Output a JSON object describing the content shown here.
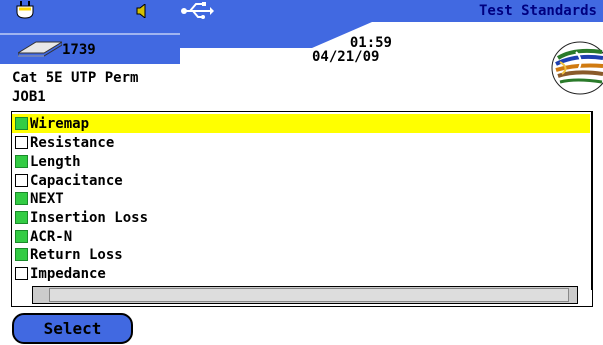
{
  "header": {
    "title": "Test Standards",
    "count": "1739",
    "time": "01:59",
    "date": "04/21/09",
    "icons": [
      "power-plug-icon",
      "speaker-icon",
      "usb-icon",
      "storage-card-icon",
      "cable-bundle-icon"
    ],
    "band_color": "#4169e1"
  },
  "info": {
    "cable_type": "Cat 5E UTP Perm",
    "job": "JOB1"
  },
  "tests": [
    {
      "label": "Wiremap",
      "checked": true,
      "selected": true
    },
    {
      "label": "Resistance",
      "checked": false,
      "selected": false
    },
    {
      "label": "Length",
      "checked": true,
      "selected": false
    },
    {
      "label": "Capacitance",
      "checked": false,
      "selected": false
    },
    {
      "label": "NEXT",
      "checked": true,
      "selected": false
    },
    {
      "label": "Insertion Loss",
      "checked": true,
      "selected": false
    },
    {
      "label": "ACR-N",
      "checked": true,
      "selected": false
    },
    {
      "label": "Return Loss",
      "checked": true,
      "selected": false
    },
    {
      "label": "Impedance",
      "checked": false,
      "selected": false
    }
  ],
  "footer": {
    "select_label": "Select"
  },
  "colors": {
    "highlight": "#ffff00",
    "check_on": "#33cc44",
    "button": "#4169e1"
  }
}
